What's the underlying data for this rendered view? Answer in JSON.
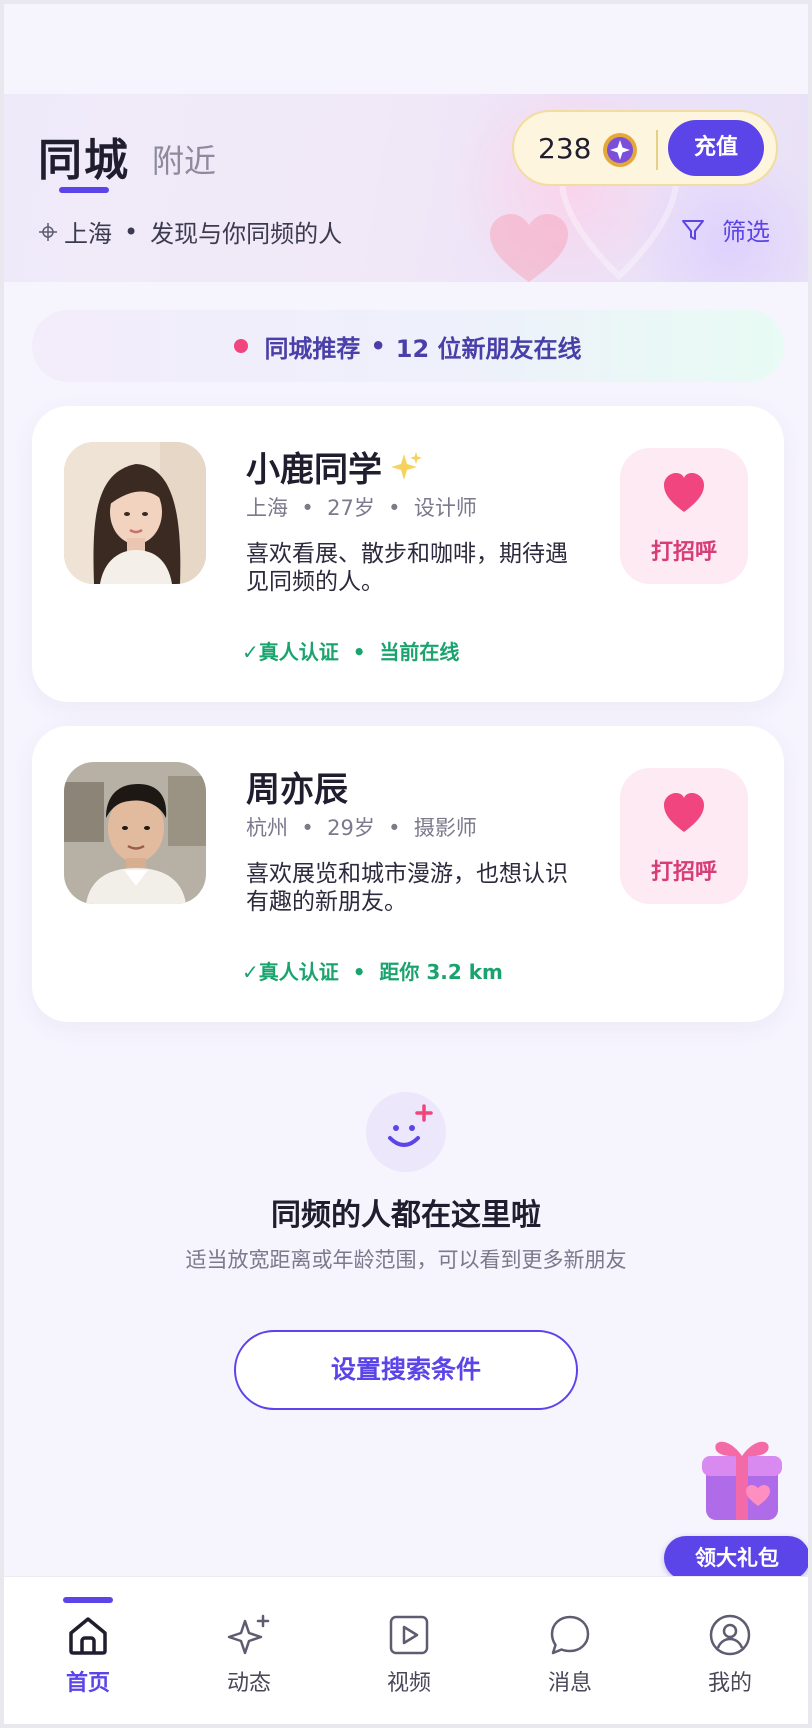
{
  "header": {
    "tab_active": "同城",
    "tab_inactive": "附近",
    "coins": "238",
    "recharge_label": "充值",
    "city": "上海",
    "tagline": "发现与你同频的人",
    "filter_label": "筛选"
  },
  "banner": {
    "title": "同城推荐",
    "online_text": "12 位新朋友在线"
  },
  "cards": [
    {
      "name": "小鹿同学",
      "city": "上海",
      "age": "27岁",
      "job": "设计师",
      "bio": "喜欢看展、散步和咖啡，期待遇见同频的人。",
      "verified": "✓真人认证",
      "status": "当前在线",
      "greet_label": "打招呼"
    },
    {
      "name": "周亦辰",
      "city": "杭州",
      "age": "29岁",
      "job": "摄影师",
      "bio": "喜欢展览和城市漫游，也想认识有趣的新朋友。",
      "verified": "✓真人认证",
      "status": "距你 3.2 km",
      "greet_label": "打招呼"
    }
  ],
  "empty_state": {
    "title": "同频的人都在这里啦",
    "subtitle": "适当放宽距离或年龄范围，可以看到更多新朋友",
    "button_label": "设置搜索条件"
  },
  "gift": {
    "label": "领大礼包"
  },
  "nav": {
    "items": [
      {
        "label": "首页",
        "icon": "home-icon"
      },
      {
        "label": "动态",
        "icon": "sparkle-icon"
      },
      {
        "label": "视频",
        "icon": "video-icon"
      },
      {
        "label": "消息",
        "icon": "chat-icon"
      },
      {
        "label": "我的",
        "icon": "profile-icon"
      }
    ]
  },
  "colors": {
    "accent": "#5b45e8",
    "pink": "#f0457e",
    "verified": "#1aa36e",
    "background": "#f6f4fd"
  }
}
